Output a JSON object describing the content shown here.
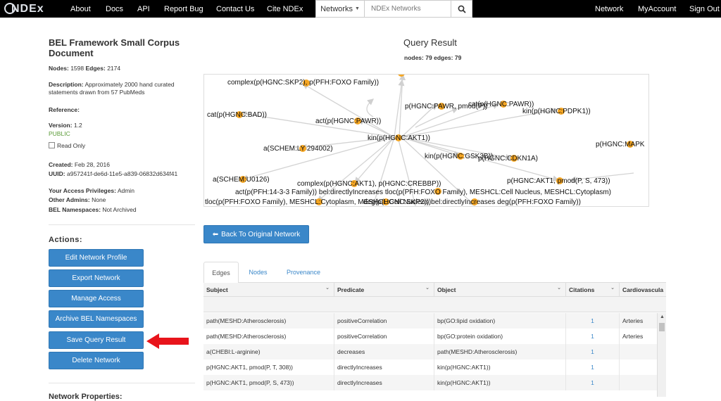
{
  "nav": {
    "logo_text": "NDEx",
    "links": [
      "About",
      "Docs",
      "API",
      "Report Bug",
      "Contact Us",
      "Cite NDEx"
    ],
    "search_select": "Networks",
    "search_placeholder": "NDEx Networks",
    "right_links": [
      "Network",
      "MyAccount",
      "Sign Out"
    ]
  },
  "network": {
    "title": "BEL Framework Small Corpus Document",
    "nodes_label": "Nodes:",
    "nodes_value": "1598",
    "edges_label": "Edges:",
    "edges_value": "2174",
    "description_label": "Description:",
    "description": "Approximately 2000 hand curated statements drawn from 57 PubMeds",
    "reference_label": "Reference:",
    "version_label": "Version:",
    "version_value": "1.2",
    "visibility": "PUBLIC",
    "read_only_label": "Read Only",
    "created_label": "Created:",
    "created_value": "Feb 28, 2016",
    "uuid_label": "UUID:",
    "uuid_value": "a957241f-de6d-11e5-a839-06832d634f41",
    "privileges_label": "Your Access Privileges:",
    "privileges_value": "Admin",
    "other_admins_label": "Other Admins:",
    "other_admins_value": "None",
    "bel_ns_label": "BEL Namespaces:",
    "bel_ns_value": "Not Archived"
  },
  "actions": {
    "heading": "Actions:",
    "buttons": [
      "Edit Network Profile",
      "Export Network",
      "Manage Access",
      "Archive BEL Namespaces",
      "Save Query Result",
      "Delete Network"
    ]
  },
  "network_properties_heading": "Network Properties:",
  "query": {
    "title": "Query Result",
    "nodes_label": "nodes:",
    "nodes_value": "79",
    "edges_label": "edges:",
    "edges_value": "79",
    "back_button": "Back To Original Network"
  },
  "graph": {
    "labels": [
      "complex(p(HGNC:SKP2), p(PFH:FOXO Family))",
      "cat(p(HGNC:BAD))",
      "act(p(HGNC:PAWR))",
      "p(HGNC:PAWR, pmod(P))",
      "cat(p(HGNC:PAWR))",
      "kin(p(HGNC:PDPK1))",
      "kin(p(HGNC:AKT1))",
      "a(SCHEM:LY 294002)",
      "kin(p(HGNC:GSK3B))",
      "p(HGNC:CDKN1A)",
      "p(HGNC:MAPK",
      "a(SCHEM:U0126)",
      "complex(p(HGNC:AKT1), p(HGNC:CREBBP))",
      "p(HGNC:AKT1, pmod(P, S, 473))",
      "act(p(PFH:14-3-3 Family)) bel:directlyIncreases tloc(p(PFH:FOXO Family), MESHCL:Cell Nucleus, MESHCL:Cytoplasm)",
      "tloc(p(PFH:FOXO Family), MESHCL:Cytoplasm, MESHCL:Cell Nucleus)",
      "deg(p(HGNC:SKP2)) bel:directlyIncreases deg(p(PFH:FOXO Family))"
    ]
  },
  "tabs": [
    "Edges",
    "Nodes",
    "Provenance"
  ],
  "table": {
    "columns": [
      "Subject",
      "Predicate",
      "Object",
      "Citations",
      "Cardiovascula"
    ],
    "rows": [
      {
        "subject": "path(MESHD:Atherosclerosis)",
        "predicate": "positiveCorrelation",
        "object": "bp(GO:lipid oxidation)",
        "citations": "1",
        "extra": "Arteries"
      },
      {
        "subject": "path(MESHD:Atherosclerosis)",
        "predicate": "positiveCorrelation",
        "object": "bp(GO:protein oxidation)",
        "citations": "1",
        "extra": "Arteries"
      },
      {
        "subject": "a(CHEBI:L-arginine)",
        "predicate": "decreases",
        "object": "path(MESHD:Atherosclerosis)",
        "citations": "1",
        "extra": ""
      },
      {
        "subject": "p(HGNC:AKT1, pmod(P, T, 308))",
        "predicate": "directlyIncreases",
        "object": "kin(p(HGNC:AKT1))",
        "citations": "1",
        "extra": ""
      },
      {
        "subject": "p(HGNC:AKT1, pmod(P, S, 473))",
        "predicate": "directlyIncreases",
        "object": "kin(p(HGNC:AKT1))",
        "citations": "1",
        "extra": ""
      }
    ]
  },
  "colors": {
    "primary": "#3a87c9",
    "node": "#f5a623",
    "public": "#5a9a36",
    "annotation_arrow": "#e8141b"
  }
}
